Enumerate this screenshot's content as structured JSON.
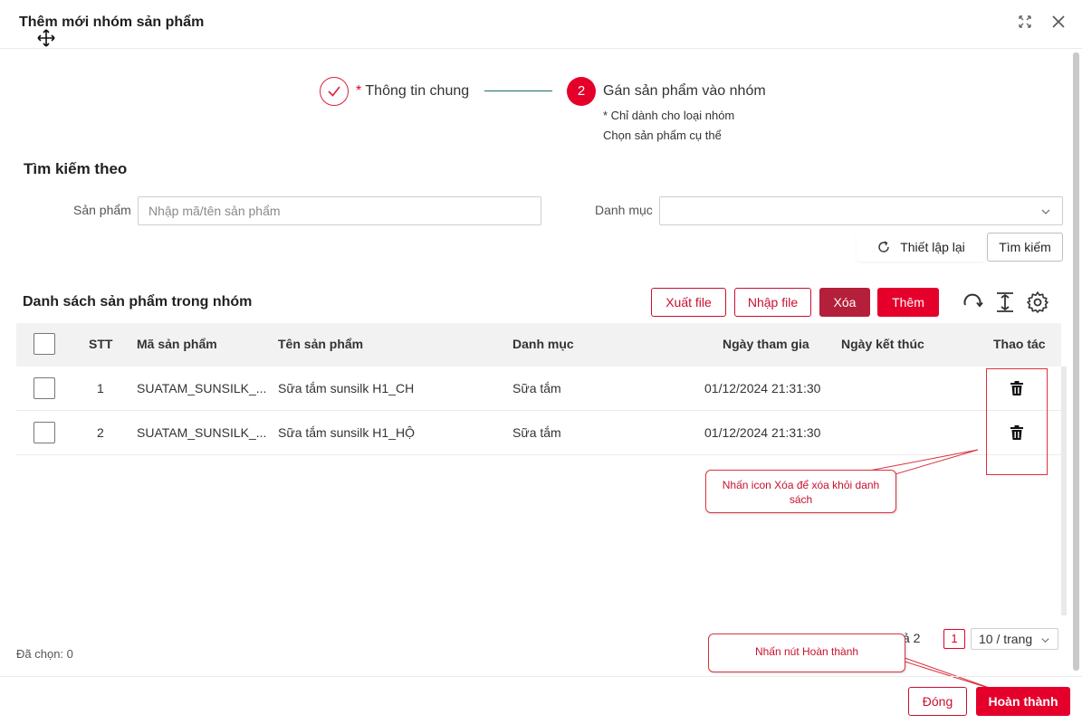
{
  "modal": {
    "title": "Thêm mới nhóm sản phẩm"
  },
  "steps": {
    "step1": {
      "required_mark": "*",
      "label": "Thông tin chung",
      "status": "completed"
    },
    "step2": {
      "number": "2",
      "label": "Gán sản phẩm vào nhóm",
      "note_line1": "* Chỉ dành cho loại nhóm",
      "note_line2": "Chọn sản phẩm cụ thể"
    }
  },
  "search": {
    "title": "Tìm kiếm theo",
    "product_label": "Sản phẩm",
    "product_placeholder": "Nhập mã/tên sản phẩm",
    "product_value": "",
    "category_label": "Danh mục",
    "category_value": "",
    "reset_label": "Thiết lập lại",
    "search_label": "Tìm kiếm"
  },
  "list": {
    "title": "Danh sách sản phẩm trong nhóm",
    "export_label": "Xuất file",
    "import_label": "Nhập file",
    "delete_label": "Xóa",
    "add_label": "Thêm",
    "columns": [
      "STT",
      "Mã sản phẩm",
      "Tên sản phẩm",
      "Danh mục",
      "Ngày tham gia",
      "Ngày kết thúc",
      "Thao tác"
    ],
    "rows": [
      {
        "stt": "1",
        "code": "SUATAM_SUNSILK_...",
        "name": "Sữa tắm sunsilk H1_CH",
        "category": "Sữa tắm",
        "joined": "01/12/2024 21:31:30",
        "ended": ""
      },
      {
        "stt": "2",
        "code": "SUATAM_SUNSILK_...",
        "name": "Sữa tắm sunsilk H1_HỘ",
        "category": "Sữa tắm",
        "joined": "01/12/2024 21:31:30",
        "ended": ""
      }
    ]
  },
  "pagination": {
    "total_text": "cả 2",
    "current_page": "1",
    "page_size": "10 / trang",
    "selected_text": "Đã chọn: 0"
  },
  "annotations": {
    "delete_hint": "Nhấn icon Xóa để xóa khỏi danh sách",
    "finish_hint": "Nhấn nút Hoàn thành"
  },
  "footer": {
    "close_label": "Đóng",
    "finish_label": "Hoàn thành"
  },
  "icons": {
    "move": "move-icon",
    "expand": "expand-icon",
    "close": "close-icon",
    "check": "check-icon",
    "chevron": "chevron-down-icon",
    "reset": "reload-icon",
    "refresh": "refresh-icon",
    "density": "column-height-icon",
    "settings": "gear-icon",
    "delete": "trash-icon"
  },
  "colors": {
    "primary": "#e4002b",
    "primary_dark": "#b4203a",
    "annotation": "#d9333f"
  }
}
